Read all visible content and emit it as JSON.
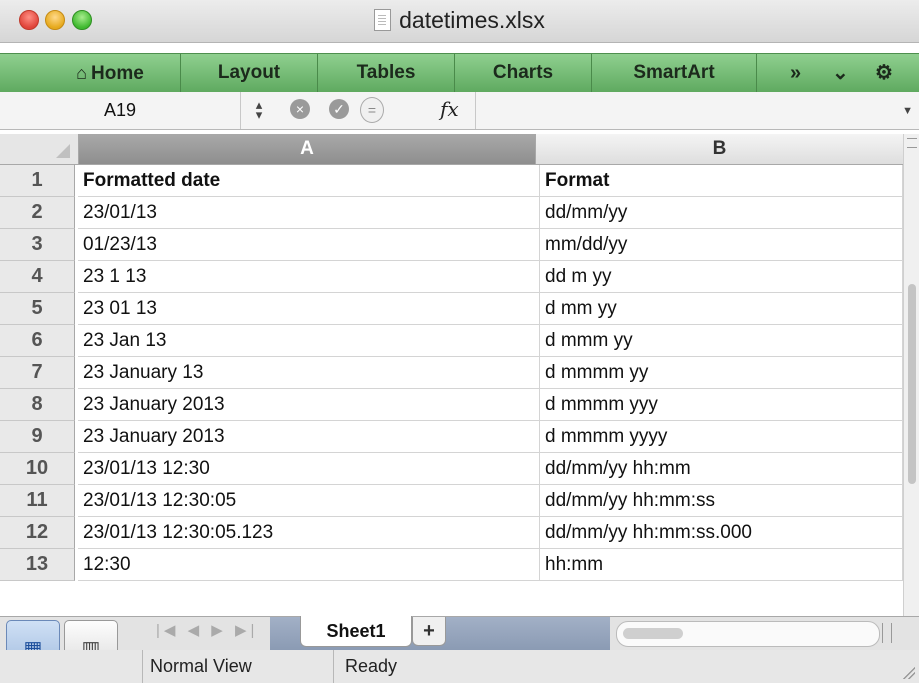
{
  "window": {
    "title": "datetimes.xlsx"
  },
  "ribbon": {
    "tabs": [
      "Home",
      "Layout",
      "Tables",
      "Charts",
      "SmartArt"
    ],
    "more_label": "»",
    "collapse_label": "⌄",
    "settings_label": "⚙"
  },
  "formula_bar": {
    "name_box": "A19",
    "fx_label": "fx",
    "content": ""
  },
  "columns": [
    "A",
    "B"
  ],
  "selected_column": "A",
  "rows": [
    {
      "num": "1",
      "a": "Formatted date",
      "b": "Format",
      "bold": true
    },
    {
      "num": "2",
      "a": "23/01/13",
      "b": "dd/mm/yy"
    },
    {
      "num": "3",
      "a": "01/23/13",
      "b": "mm/dd/yy"
    },
    {
      "num": "4",
      "a": "23 1 13",
      "b": "dd m yy"
    },
    {
      "num": "5",
      "a": "23 01 13",
      "b": "d mm yy"
    },
    {
      "num": "6",
      "a": "23 Jan 13",
      "b": "d mmm yy"
    },
    {
      "num": "7",
      "a": "23 January 13",
      "b": "d mmmm yy"
    },
    {
      "num": "8",
      "a": "23 January 2013",
      "b": "d mmmm yyy"
    },
    {
      "num": "9",
      "a": "23 January 2013",
      "b": "d mmmm yyyy"
    },
    {
      "num": "10",
      "a": "23/01/13 12:30",
      "b": "dd/mm/yy hh:mm"
    },
    {
      "num": "11",
      "a": "23/01/13 12:30:05",
      "b": "dd/mm/yy hh:mm:ss"
    },
    {
      "num": "12",
      "a": "23/01/13 12:30:05.123",
      "b": "dd/mm/yy hh:mm:ss.000"
    },
    {
      "num": "13",
      "a": "12:30",
      "b": "hh:mm"
    }
  ],
  "sheets": {
    "active": "Sheet1",
    "add_label": "+"
  },
  "status": {
    "view": "Normal View",
    "state": "Ready"
  },
  "icons": {
    "nav_arrows": "|◀ ◀ ▶ ▶|",
    "normal_view": "▦",
    "page_layout_view": "▥"
  }
}
